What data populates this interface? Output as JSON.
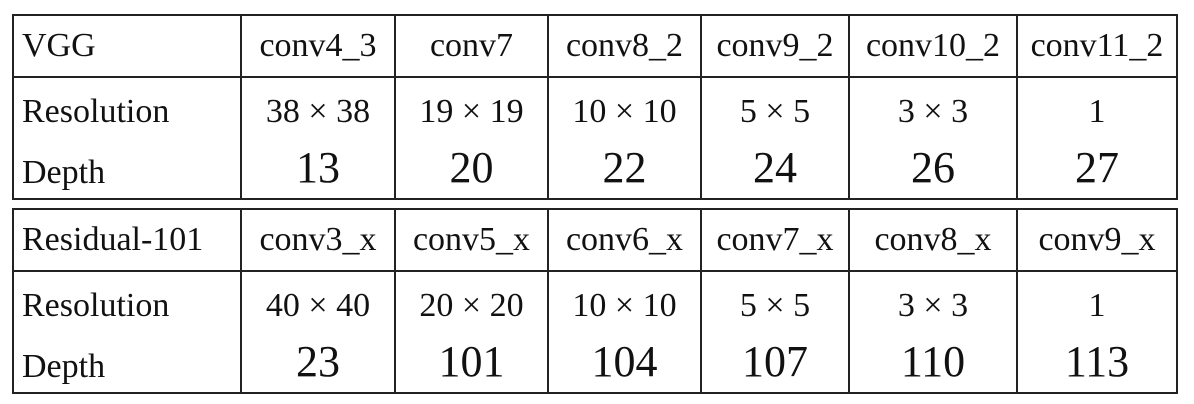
{
  "tables": [
    {
      "header": [
        "VGG",
        "conv4_3",
        "conv7",
        "conv8_2",
        "conv9_2",
        "conv10_2",
        "conv11_2"
      ],
      "rows": [
        {
          "label": "Resolution",
          "values": [
            "38 × 38",
            "19 × 19",
            "10 × 10",
            "5 × 5",
            "3 × 3",
            "1"
          ]
        },
        {
          "label": "Depth",
          "values": [
            "13",
            "20",
            "22",
            "24",
            "26",
            "27"
          ]
        }
      ]
    },
    {
      "header": [
        "Residual-101",
        "conv3_x",
        "conv5_x",
        "conv6_x",
        "conv7_x",
        "conv8_x",
        "conv9_x"
      ],
      "rows": [
        {
          "label": "Resolution",
          "values": [
            "40 × 40",
            "20 × 20",
            "10 × 10",
            "5 × 5",
            "3 × 3",
            "1"
          ]
        },
        {
          "label": "Depth",
          "values": [
            "23",
            "101",
            "104",
            "107",
            "110",
            "113"
          ]
        }
      ]
    }
  ]
}
